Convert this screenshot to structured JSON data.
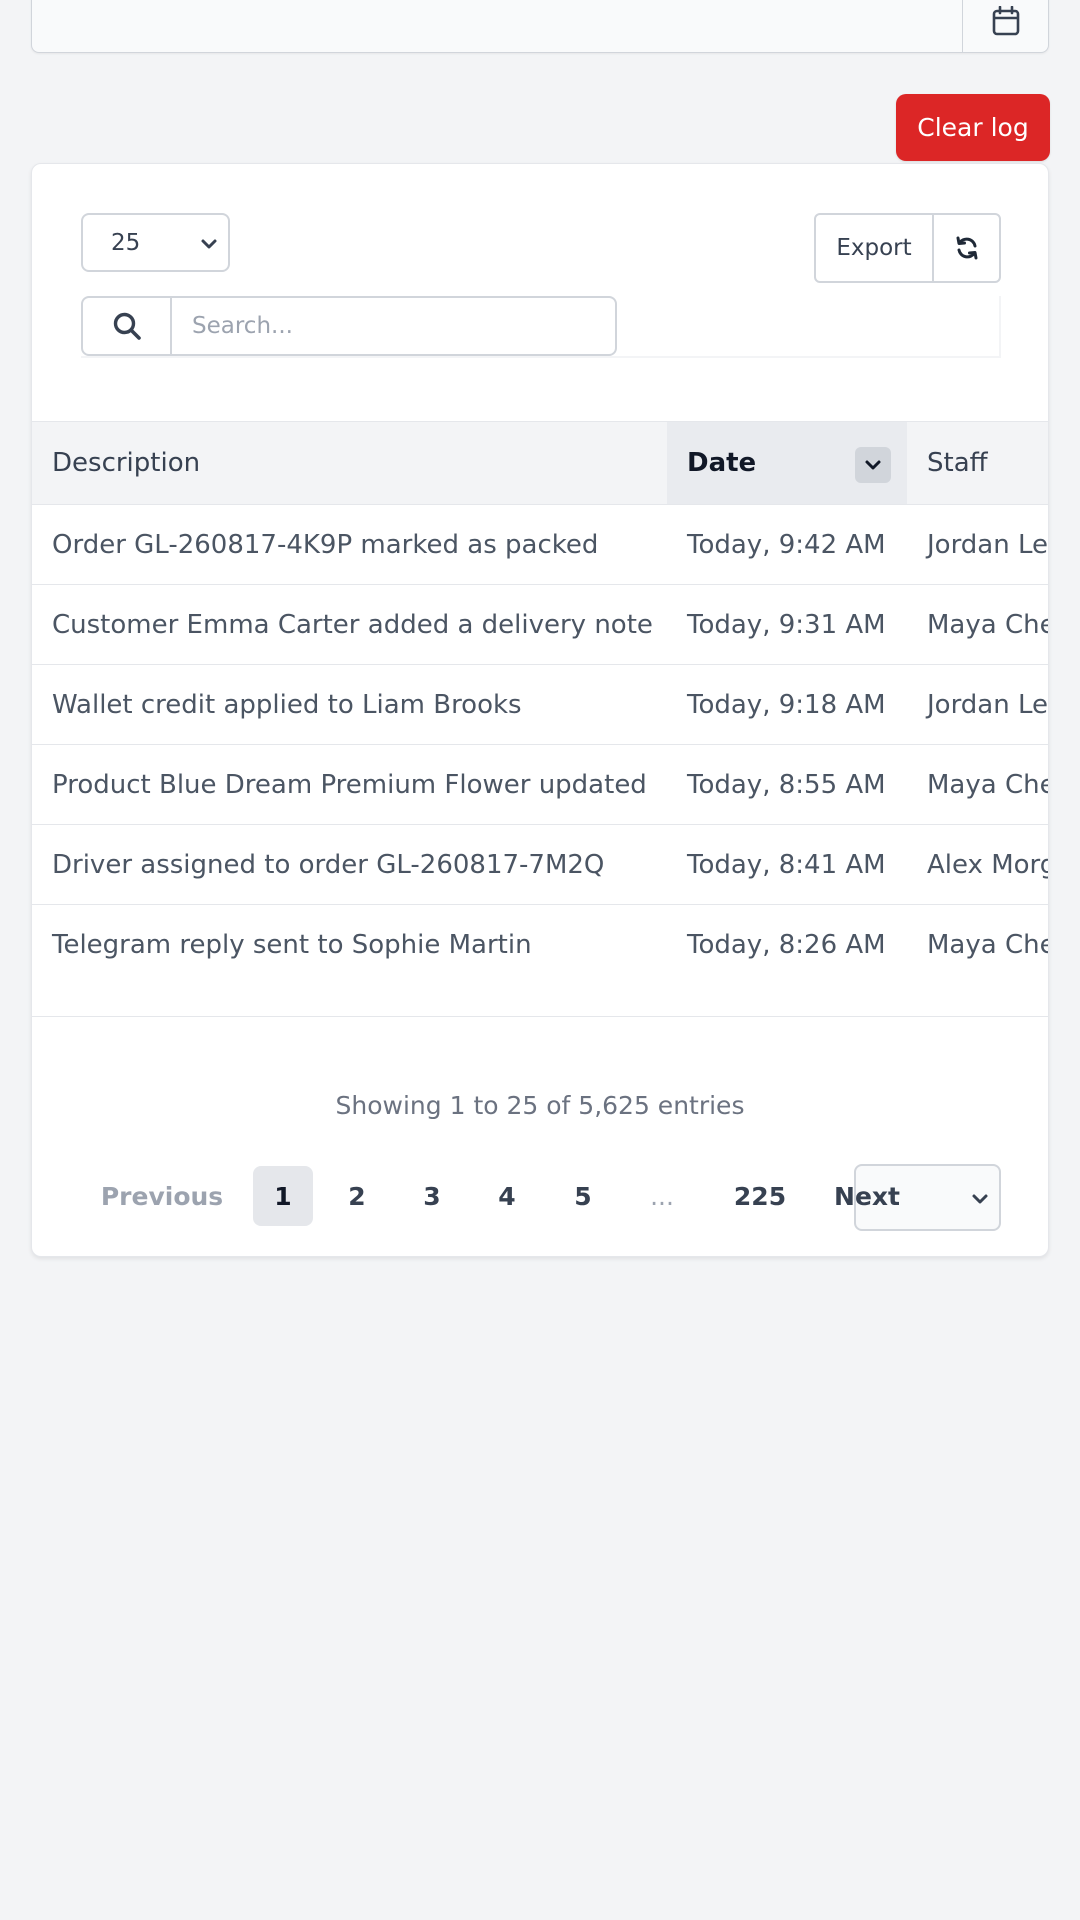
{
  "filter": {
    "calendar_icon": "calendar-icon"
  },
  "actions": {
    "clear_log_label": "Clear log"
  },
  "table_controls": {
    "page_size": "25",
    "export_label": "Export",
    "refresh_icon": "refresh-icon",
    "search_placeholder": "Search..."
  },
  "table": {
    "columns": [
      "Description",
      "Date",
      "Staff"
    ],
    "rows": [
      {
        "description": "Order GL-260817-4K9P marked as packed",
        "date": "Today, 9:42 AM",
        "staff": "Jordan Lee"
      },
      {
        "description": "Customer Emma Carter added a delivery note",
        "date": "Today, 9:31 AM",
        "staff": "Maya Chen"
      },
      {
        "description": "Wallet credit applied to Liam Brooks",
        "date": "Today, 9:18 AM",
        "staff": "Jordan Lee"
      },
      {
        "description": "Product Blue Dream Premium Flower updated",
        "date": "Today, 8:55 AM",
        "staff": "Maya Chen"
      },
      {
        "description": "Driver assigned to order GL-260817-7M2Q",
        "date": "Today, 8:41 AM",
        "staff": "Alex Morgan"
      },
      {
        "description": "Telegram reply sent to Sophie Martin",
        "date": "Today, 8:26 AM",
        "staff": "Maya Chen"
      }
    ]
  },
  "pagination": {
    "summary": "Showing 1 to 25 of 5,625 entries",
    "previous": "Previous",
    "pages": [
      "1",
      "2",
      "3",
      "4",
      "5"
    ],
    "ellipsis": "...",
    "last_page": "225",
    "next": "Next"
  }
}
